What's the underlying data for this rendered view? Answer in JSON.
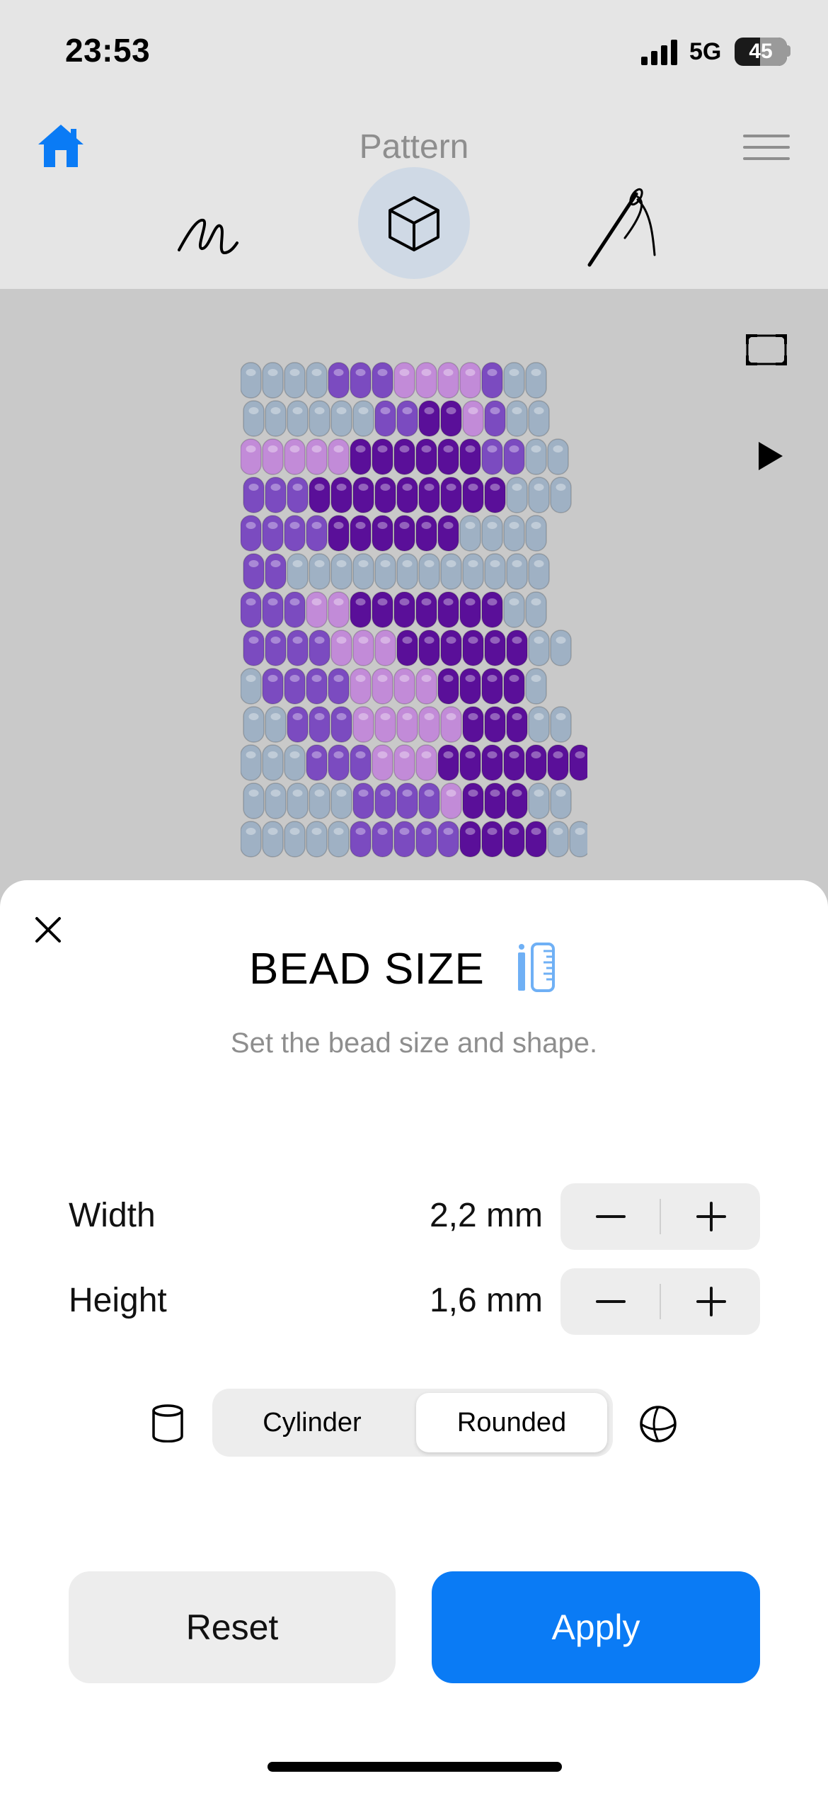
{
  "status": {
    "time": "23:53",
    "network": "5G",
    "battery": "45"
  },
  "nav": {
    "title": "Pattern",
    "active_tab": "3d-view"
  },
  "colors": {
    "accent": "#0a7bf5",
    "bead_gray": "#9fb1c4",
    "bead_violet": "#7b4bc0",
    "bead_pink": "#c28bd8",
    "bead_deep_purple": "#5a0f99"
  },
  "beads": {
    "legend": {
      "g": "gray-blue",
      "v": "violet",
      "p": "light-pink",
      "d": "deep-purple"
    },
    "rows": [
      "ggggvvvppppvgg",
      "ggggggvvddpvgg",
      "pppppddddddvvgg",
      "vvvdddddddddggg",
      "vvvvddddddgggg",
      "vvgggggggggggg",
      "vvvppdddddddgg",
      "vvvvpppddddddgg",
      "gvvvvppppddddg",
      "ggvvvpppppdddgg",
      "gggvvvpppddddddd",
      "gggggvvvvpdddgg",
      "gggggvvvvvddddgg"
    ]
  },
  "sheet": {
    "title": "BEAD SIZE",
    "subtitle": "Set the bead size and shape.",
    "width_label": "Width",
    "width_value": "2,2 mm",
    "height_label": "Height",
    "height_value": "1,6 mm",
    "shape_options": [
      "Cylinder",
      "Rounded"
    ],
    "selected_shape": "Rounded",
    "reset_label": "Reset",
    "apply_label": "Apply"
  }
}
